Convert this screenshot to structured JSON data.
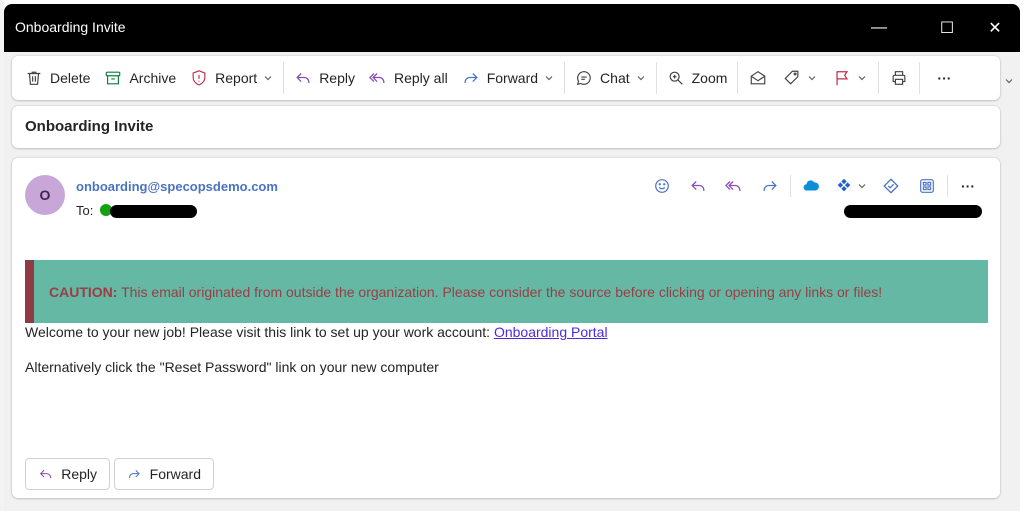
{
  "window": {
    "title": "Onboarding Invite",
    "controls": {
      "minimize": "—",
      "maximize": "☐",
      "close": "✕"
    }
  },
  "toolbar": {
    "delete_label": "Delete",
    "archive_label": "Archive",
    "report_label": "Report",
    "reply_label": "Reply",
    "reply_all_label": "Reply all",
    "forward_label": "Forward",
    "chat_label": "Chat",
    "zoom_label": "Zoom",
    "more_label": "···"
  },
  "subject": "Onboarding Invite",
  "message": {
    "avatar_initial": "O",
    "sender": "onboarding@specopsdemo.com",
    "to_label": "To:",
    "more_label": "···",
    "caution_label": "CAUTION:",
    "caution_text": " This email originated from outside the organization. Please consider the source before clicking or opening any links or files!",
    "line1_text": "Welcome to your new job! Please visit this link to set up your work account: ",
    "line1_link": "Onboarding Portal",
    "line2_text": "Alternatively click the \"Reset Password\" link on your new computer",
    "reply_button": "Reply",
    "forward_button": "Forward"
  },
  "colors": {
    "accent_blue": "#4a73c4",
    "caution_bg": "#64b8a4",
    "caution_bar": "#8e3b46",
    "caution_text": "#9c3d46",
    "reply_purple": "#8a4bb8",
    "link": "#4f2bd8"
  }
}
